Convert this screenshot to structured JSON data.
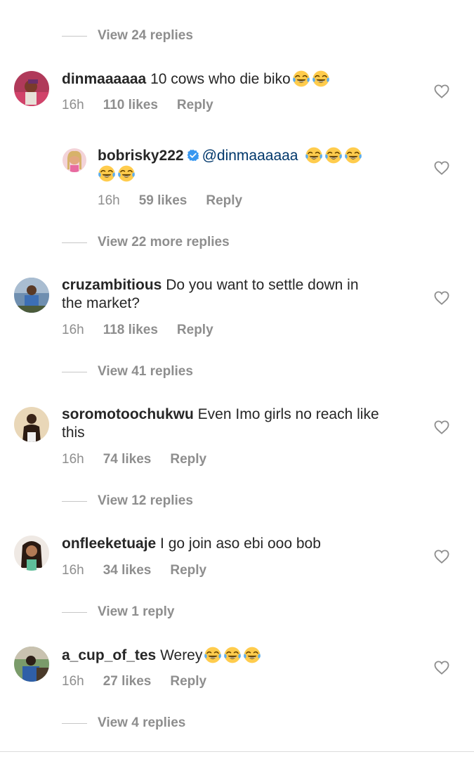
{
  "colors": {
    "text": "#262626",
    "secondary": "#8e8e8e",
    "mention": "#00376b",
    "verified": "#3897f0",
    "divider": "#c7c7c7"
  },
  "top_view_replies": "View 24 replies",
  "comments": [
    {
      "username": "dinmaaaaaa",
      "text": " 10 cows who die biko",
      "emoji_icons": [
        "face-with-tears-of-joy-icon",
        "face-with-tears-of-joy-icon"
      ],
      "time": "16h",
      "likes": "110 likes",
      "reply": "Reply",
      "view_replies": "View 22 more replies",
      "reply_item": {
        "username": "bobrisky222",
        "verified_icon": "verified-badge-icon",
        "mention": "@dinmaaaaaa",
        "emoji_icons": [
          "face-with-tears-of-joy-icon",
          "face-with-tears-of-joy-icon",
          "face-with-tears-of-joy-icon",
          "face-with-tears-of-joy-icon",
          "face-with-tears-of-joy-icon"
        ],
        "time": "16h",
        "likes": "59 likes",
        "reply": "Reply"
      }
    },
    {
      "username": "cruzambitious",
      "text_line1": " Do you want to settle down in",
      "text_line2": "the market?",
      "time": "16h",
      "likes": "118 likes",
      "reply": "Reply",
      "view_replies": "View 41 replies"
    },
    {
      "username": "soromotoochukwu",
      "text_line1": " Even Imo girls no reach like",
      "text_line2": "this",
      "time": "16h",
      "likes": "74 likes",
      "reply": "Reply",
      "view_replies": "View 12 replies"
    },
    {
      "username": "onfleeketuaje",
      "text": " I go join aso ebi ooo bob",
      "time": "16h",
      "likes": "34 likes",
      "reply": "Reply",
      "view_replies": "View 1 reply"
    },
    {
      "username": "a_cup_of_tes",
      "text": " Werey",
      "emoji_icons": [
        "face-with-tears-of-joy-icon",
        "face-with-tears-of-joy-icon",
        "face-with-tears-of-joy-icon"
      ],
      "time": "16h",
      "likes": "27 likes",
      "reply": "Reply",
      "view_replies": "View 4 replies"
    }
  ],
  "icons": {
    "heart": "heart-outline-icon"
  }
}
